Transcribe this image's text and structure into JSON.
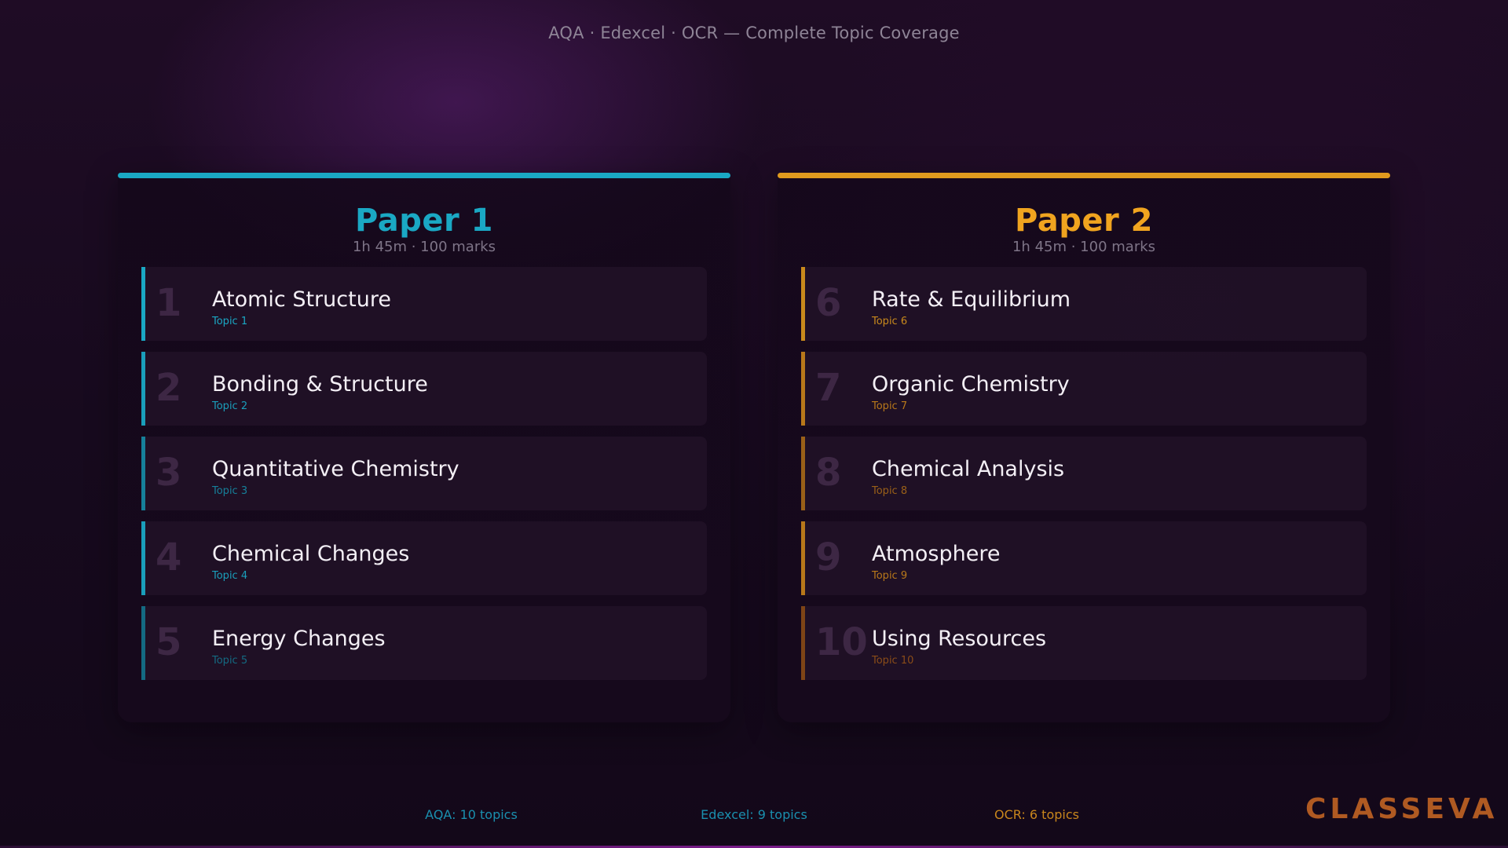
{
  "header": {
    "subtitle": "AQA · Edexcel · OCR — Complete Topic Coverage"
  },
  "colors": {
    "paper1_accent": "#1aa8c4",
    "paper2_accent": "#e09a1e",
    "logo": "#b05a22"
  },
  "papers": [
    {
      "title": "Paper 1",
      "meta": "1h 45m · 100 marks",
      "topics": [
        {
          "number": "1",
          "name": "Atomic Structure",
          "label": "Topic 1"
        },
        {
          "number": "2",
          "name": "Bonding & Structure",
          "label": "Topic 2"
        },
        {
          "number": "3",
          "name": "Quantitative Chemistry",
          "label": "Topic 3"
        },
        {
          "number": "4",
          "name": "Chemical Changes",
          "label": "Topic 4"
        },
        {
          "number": "5",
          "name": "Energy Changes",
          "label": "Topic 5"
        }
      ]
    },
    {
      "title": "Paper 2",
      "meta": "1h 45m · 100 marks",
      "topics": [
        {
          "number": "6",
          "name": "Rate & Equilibrium",
          "label": "Topic 6"
        },
        {
          "number": "7",
          "name": "Organic Chemistry",
          "label": "Topic 7"
        },
        {
          "number": "8",
          "name": "Chemical Analysis",
          "label": "Topic 8"
        },
        {
          "number": "9",
          "name": "Atmosphere",
          "label": "Topic 9"
        },
        {
          "number": "10",
          "name": "Using Resources",
          "label": "Topic 10"
        }
      ]
    }
  ],
  "footer": {
    "aqa": "AQA: 10 topics",
    "edexcel": "Edexcel: 9 topics",
    "ocr": "OCR: 6 topics"
  },
  "logo": {
    "text": "CLASSEVA"
  }
}
